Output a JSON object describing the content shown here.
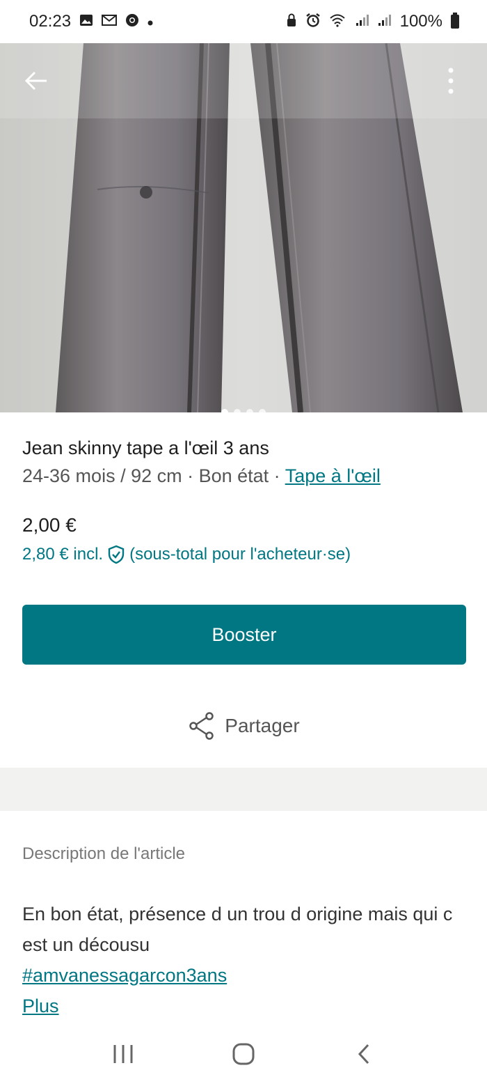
{
  "status_bar": {
    "time": "02:23",
    "battery": "100%"
  },
  "product": {
    "title": "Jean skinny tape a l'œil 3 ans",
    "size": "24-36 mois / 92 cm",
    "condition": "Bon état",
    "separator": " · ",
    "brand": "Tape à l'œil",
    "price": "2,00 €",
    "price_incl": "2,80 € incl.",
    "price_incl_note": "(sous-total pour l'acheteur·se)"
  },
  "actions": {
    "booster_label": "Booster",
    "share_label": "Partager"
  },
  "description": {
    "heading": "Description de l'article",
    "text": "En bon état, présence d un trou d origine mais qui c est un décousu",
    "hashtag": "#amvanessagarcon3ans",
    "more": "Plus"
  },
  "colors": {
    "accent": "#007782",
    "band": "#f2f2f0"
  },
  "icons": [
    "back-arrow-icon",
    "more-vertical-icon",
    "shield-check-icon",
    "share-icon",
    "recent-apps-icon",
    "home-icon",
    "nav-back-icon"
  ],
  "gallery": {
    "dot_count": 4
  }
}
